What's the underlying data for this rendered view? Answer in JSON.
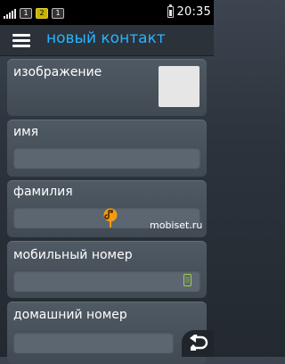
{
  "status_bar": {
    "sim1": "1",
    "sim2": "2",
    "sim3": "1",
    "time": "20:35"
  },
  "header": {
    "title": "новый контакт"
  },
  "form": {
    "image_label": "изображение",
    "first_name_label": "имя",
    "first_name_value": "",
    "last_name_label": "фамилия",
    "last_name_value": "",
    "mobile_label": "мобильный номер",
    "mobile_value": "",
    "home_label": "домашний номер"
  },
  "watermark": "mobiset.ru",
  "icons": {
    "menu": "menu-icon",
    "back": "back-icon",
    "phone": "phone-icon",
    "cursor": "text-cursor-icon"
  },
  "colors": {
    "accent": "#29b3ff",
    "status_bar": "#000000",
    "card": "#4a535c",
    "field": "#5c6670",
    "mobile_icon": "#9fd14a"
  }
}
